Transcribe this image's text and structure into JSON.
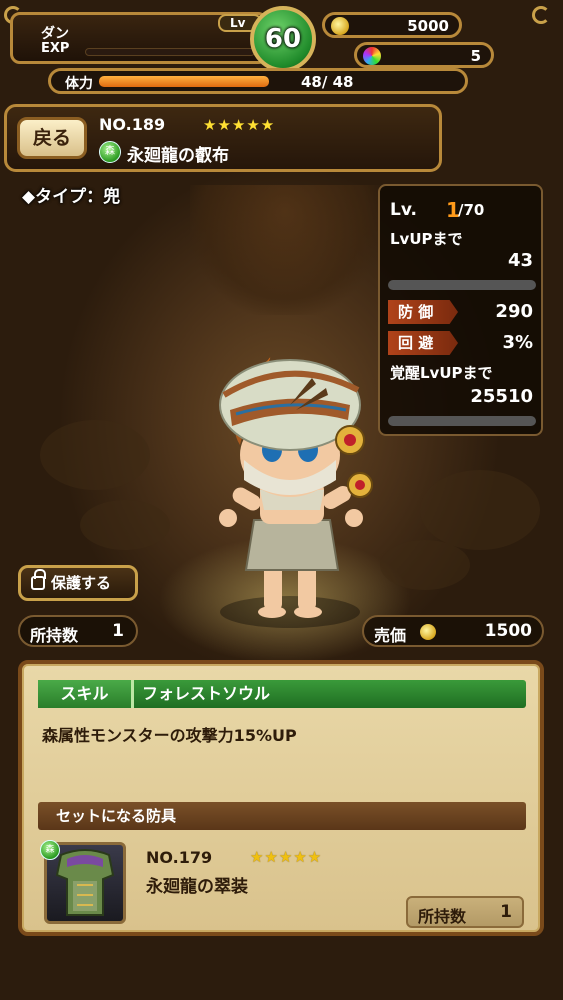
{
  "player": {
    "name": "ダン",
    "exp_label": "EXP",
    "exp_fraction": 0.0,
    "level_label": "Lv",
    "level": "60",
    "coins": "5000",
    "gems": "5",
    "stamina_label": "体力",
    "stamina_fraction": 1.0,
    "stamina_text": "48/ 48"
  },
  "item": {
    "back_label": "戻る",
    "number": "NO.189",
    "stars": "★★★★★",
    "element_label": "森",
    "name": "永廻龍の叡布",
    "type_line": "◆タイプ：兜"
  },
  "stats": {
    "lv_label": "Lv.",
    "lv_current": "1",
    "lv_max": "/70",
    "lvup_label": "LvUPまで",
    "lvup_value": "43",
    "defense_label": "防 御",
    "defense_value": "290",
    "evade_label": "回 避",
    "evade_value": "3%",
    "awaken_label": "覚醒LvUPまで",
    "awaken_value": "25510"
  },
  "actions": {
    "protect_label": "保護する",
    "owned_label": "所持数",
    "owned_value": "1",
    "sell_label": "売価",
    "sell_value": "1500"
  },
  "skill": {
    "tag": "スキル",
    "name": "フォレストソウル",
    "description": "森属性モンスターの攻撃力15%UP"
  },
  "set": {
    "header": "セットになる防具",
    "element_label": "森",
    "number": "NO.179",
    "stars": "★★★★★",
    "name": "永廻龍の翠装",
    "owned_label": "所持数",
    "owned_value": "1"
  },
  "colors": {
    "frame_gold": "#b8893a",
    "level_green": "#1f8a2a",
    "skill_green": "#2a7e2a",
    "stat_tag": "#b0431a",
    "parchment": "#e9d8a8"
  }
}
